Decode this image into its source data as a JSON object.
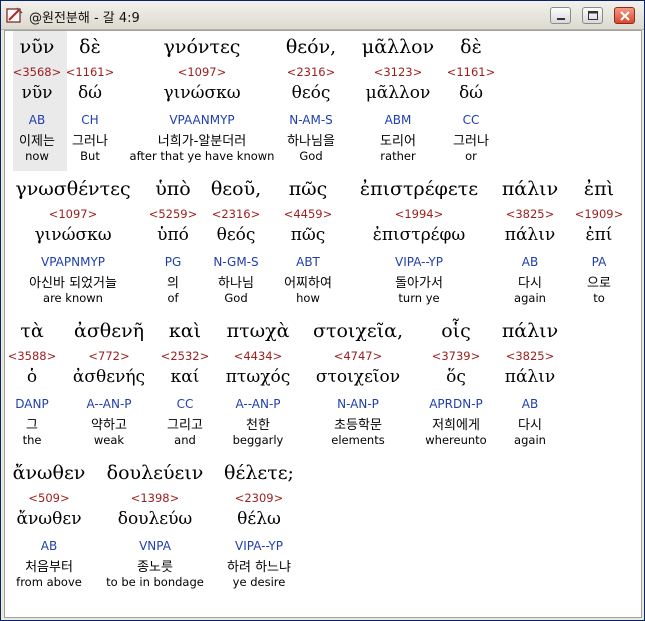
{
  "window": {
    "title": "@원전분해 - 갈 4:9",
    "icon": "bible-app-icon",
    "minimize_icon": "minimize-icon",
    "maximize_icon": "maximize-icon",
    "close_icon": "close-icon"
  },
  "colors": {
    "strong": "#9c1d1d",
    "parse": "#1f3fae",
    "selection": "#eaeaea"
  },
  "words": [
    {
      "greek": "νῦν",
      "strong": "<3568>",
      "lemma": "νῦν",
      "parse": "AB",
      "kor": "이제는",
      "eng": "now"
    },
    {
      "greek": "δὲ",
      "strong": "<1161>",
      "lemma": "δώ",
      "parse": "CH",
      "kor": "그러나",
      "eng": "But"
    },
    {
      "greek": "γνόντες",
      "strong": "<1097>",
      "lemma": "γινώσκω",
      "parse": "VPAANMYP",
      "kor": "너희가-알분더러",
      "eng": "after that ye have known"
    },
    {
      "greek": "θεόν,",
      "strong": "<2316>",
      "lemma": "θεός",
      "parse": "N-AM-S",
      "kor": "하나님을",
      "eng": "God"
    },
    {
      "greek": "μᾶλλον",
      "strong": "<3123>",
      "lemma": "μᾶλλον",
      "parse": "ABM",
      "kor": "도리어",
      "eng": "rather"
    },
    {
      "greek": "δὲ",
      "strong": "<1161>",
      "lemma": "δώ",
      "parse": "CC",
      "kor": "그러나",
      "eng": "or"
    },
    {
      "greek": "γνωσθέντες",
      "strong": "<1097>",
      "lemma": "γινώσκω",
      "parse": "VPAPNMYP",
      "kor": "아신바 되었거늘",
      "eng": "are known"
    },
    {
      "greek": "ὑπὸ",
      "strong": "<5259>",
      "lemma": "ὑπό",
      "parse": "PG",
      "kor": "의",
      "eng": "of"
    },
    {
      "greek": "θεοῦ,",
      "strong": "<2316>",
      "lemma": "θεός",
      "parse": "N-GM-S",
      "kor": "하나님",
      "eng": "God"
    },
    {
      "greek": "πῶς",
      "strong": "<4459>",
      "lemma": "πῶς",
      "parse": "ABT",
      "kor": "어찌하여",
      "eng": "how"
    },
    {
      "greek": "ἐπιστρέφετε",
      "strong": "<1994>",
      "lemma": "ἐπιστρέφω",
      "parse": "VIPA--YP",
      "kor": "돌아가서",
      "eng": "turn ye"
    },
    {
      "greek": "πάλιν",
      "strong": "<3825>",
      "lemma": "πάλιν",
      "parse": "AB",
      "kor": "다시",
      "eng": "again"
    },
    {
      "greek": "ἐπὶ",
      "strong": "<1909>",
      "lemma": "ἐπί",
      "parse": "PA",
      "kor": "으로",
      "eng": "to"
    },
    {
      "greek": "τὰ",
      "strong": "<3588>",
      "lemma": "ὁ",
      "parse": "DANP",
      "kor": "그",
      "eng": "the"
    },
    {
      "greek": "ἀσθενῆ",
      "strong": "<772>",
      "lemma": "ἀσθενής",
      "parse": "A--AN-P",
      "kor": "약하고",
      "eng": "weak"
    },
    {
      "greek": "καὶ",
      "strong": "<2532>",
      "lemma": "καί",
      "parse": "CC",
      "kor": "그리고",
      "eng": "and"
    },
    {
      "greek": "πτωχὰ",
      "strong": "<4434>",
      "lemma": "πτωχός",
      "parse": "A--AN-P",
      "kor": "천한",
      "eng": "beggarly"
    },
    {
      "greek": "στοιχεῖα,",
      "strong": "<4747>",
      "lemma": "στοιχεῖον",
      "parse": "N-AN-P",
      "kor": "초등학문",
      "eng": "elements"
    },
    {
      "greek": "οἷς",
      "strong": "<3739>",
      "lemma": "ὅς",
      "parse": "APRDN-P",
      "kor": "저희에게",
      "eng": "whereunto"
    },
    {
      "greek": "πάλιν",
      "strong": "<3825>",
      "lemma": "πάλιν",
      "parse": "AB",
      "kor": "다시",
      "eng": "again"
    },
    {
      "greek": "ἄνωθεν",
      "strong": "<509>",
      "lemma": "ἄνωθεν",
      "parse": "AB",
      "kor": "처음부터",
      "eng": "from above"
    },
    {
      "greek": "δουλεύειν",
      "strong": "<1398>",
      "lemma": "δουλεύω",
      "parse": "VNPA",
      "kor": "종노릇",
      "eng": "to be in bondage"
    },
    {
      "greek": "θέλετε;",
      "strong": "<2309>",
      "lemma": "θέλω",
      "parse": "VIPA--YP",
      "kor": "하려 하느냐",
      "eng": "ye desire"
    }
  ]
}
